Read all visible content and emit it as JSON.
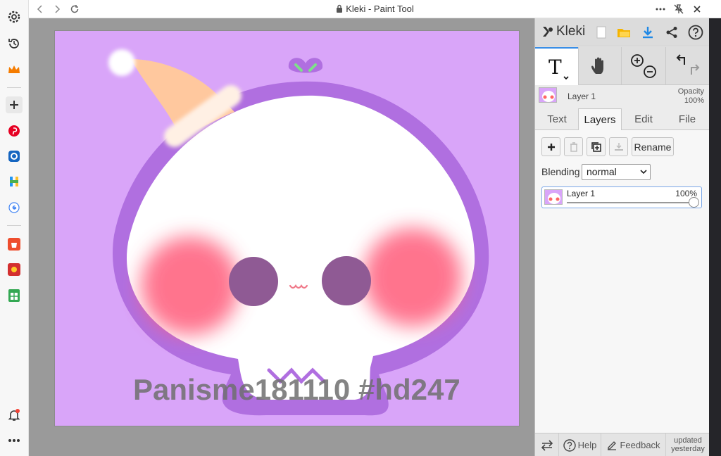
{
  "window": {
    "title": "Kleki - Paint Tool"
  },
  "canvas": {
    "background": "#d9a5f9",
    "watermark": "Panisme181110 #hd247"
  },
  "panel": {
    "logo_text": "Kleki",
    "layer_name": "Layer 1",
    "opacity_label": "Opacity",
    "opacity_value": "100%",
    "tabs": [
      {
        "label": "Text"
      },
      {
        "label": "Layers"
      },
      {
        "label": "Edit"
      },
      {
        "label": "File"
      }
    ],
    "rename_label": "Rename",
    "blending_label": "Blending",
    "blending_value": "normal",
    "layer_row": {
      "name": "Layer 1",
      "opacity": "100%",
      "level": 1.0
    },
    "footer": {
      "help": "Help",
      "feedback": "Feedback",
      "updated": "updated yesterday"
    }
  },
  "colors": {
    "accent": "#3a8ee6",
    "download": "#1e88e5",
    "notification": "#f44336"
  }
}
